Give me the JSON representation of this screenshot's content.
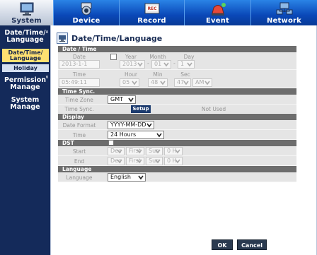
{
  "nav": {
    "tabs": [
      {
        "label": "System",
        "active": true
      },
      {
        "label": "Device",
        "active": false
      },
      {
        "label": "Record",
        "active": false
      },
      {
        "label": "Event",
        "active": false
      },
      {
        "label": "Network",
        "active": false
      }
    ],
    "record_badge": "REC"
  },
  "sidebar": {
    "items": [
      {
        "label_1": "Date/Time/",
        "label_2": "Language",
        "expanded": true
      },
      {
        "label_1": "Permission",
        "label_2": "Manage",
        "expanded": true
      },
      {
        "label_1": "System",
        "label_2": "Manage",
        "expanded": false
      }
    ],
    "subitems": [
      {
        "label_1": "Date/Time/",
        "label_2": "Language",
        "selected": true
      },
      {
        "label_1": "Holiday",
        "label_2": "",
        "selected": false
      }
    ]
  },
  "page": {
    "title": "Date/Time/Language"
  },
  "sections": {
    "date_time": "Date / Time",
    "time_sync": "Time Sync.",
    "display": "Display",
    "dst": "DST",
    "language": "Language"
  },
  "date_time": {
    "date_label": "Date",
    "date_value": "2013-1-1",
    "year_label": "Year",
    "month_label": "Month",
    "day_label": "Day",
    "year_value": "2013",
    "month_value": "01",
    "day_value": "1",
    "time_label": "Time",
    "time_value": "05:49:11",
    "hour_label": "Hour",
    "min_label": "Min",
    "sec_label": "Sec",
    "hour_value": "05",
    "min_value": "48",
    "sec_value": "47",
    "ampm_value": "AM",
    "separator": "-"
  },
  "time_sync": {
    "timezone_label": "Time Zone",
    "timezone_value": "GMT",
    "sync_label": "Time Sync.",
    "setup_label": "Setup",
    "status": "Not Used"
  },
  "display": {
    "date_format_label": "Date Format",
    "date_format_value": "YYYY-MM-DD",
    "time_label": "Time",
    "time_value": "24 Hours"
  },
  "dst": {
    "start_label": "Start",
    "end_label": "End",
    "month": "Dec",
    "week": "First",
    "weekday": "Sun",
    "hour": "0 H"
  },
  "language": {
    "label": "Language",
    "value": "English"
  },
  "buttons": {
    "ok": "OK",
    "cancel": "Cancel"
  },
  "colors": {
    "nav_bg": "#0e1d3a",
    "sidebar_bg": "#142a5a",
    "section_header": "#6d6d6d",
    "row_bg": "#e5e5e5",
    "selected_item": "#ffe071"
  }
}
